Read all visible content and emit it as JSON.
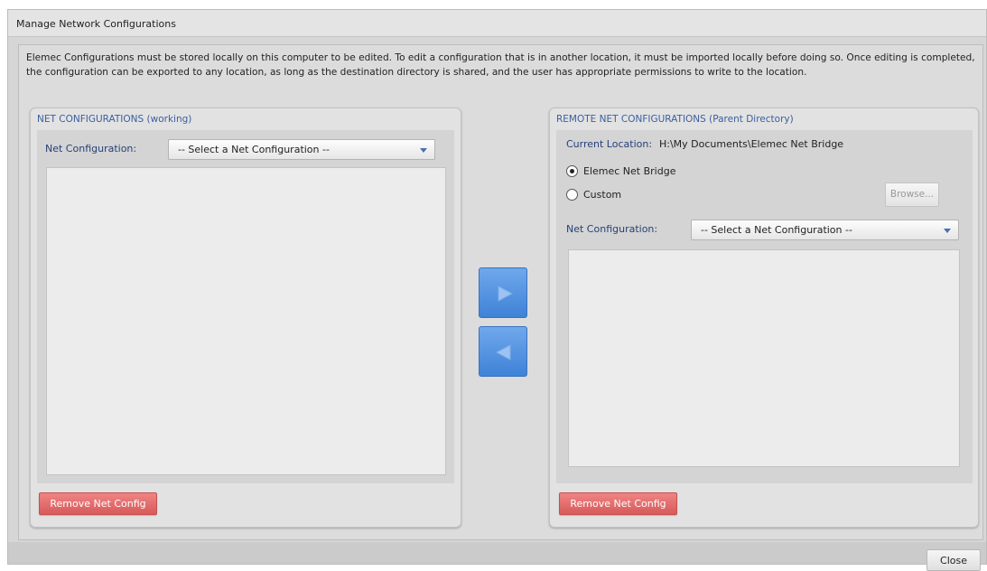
{
  "window": {
    "title": "Manage Network Configurations"
  },
  "description": "Elemec Configurations must be stored locally on this computer to be edited. To edit a configuration that is in another location, it must be imported locally before doing so. Once editing is completed, the configuration can be exported to any location, as long as the destination directory is shared, and the user has appropriate permissions to write to the location.",
  "left_panel": {
    "header": "NET CONFIGURATIONS (working)",
    "net_config_label": "Net Configuration:",
    "net_config_value": "-- Select a Net Configuration --",
    "remove_label": "Remove Net Config"
  },
  "transfer": {
    "export_icon": "arrow-right-icon",
    "import_icon": "arrow-left-icon"
  },
  "right_panel": {
    "header": "REMOTE NET CONFIGURATIONS (Parent Directory)",
    "current_location_label": "Current Location:",
    "current_location_value": "H:\\My Documents\\Elemec Net Bridge",
    "radio_options": [
      {
        "label": "Elemec Net Bridge",
        "selected": true
      },
      {
        "label": "Custom",
        "selected": false
      }
    ],
    "browse_label": "Browse...",
    "net_config_label": "Net Configuration:",
    "net_config_value": "-- Select a Net Configuration --",
    "remove_label": "Remove Net Config"
  },
  "footer": {
    "close_label": "Close"
  },
  "colors": {
    "header_text": "#3a5fa0",
    "label_text": "#26407a",
    "remove_button": "#e07070",
    "arrow_button": "#5a96e2",
    "dialog_bg": "#d6d6d6"
  }
}
